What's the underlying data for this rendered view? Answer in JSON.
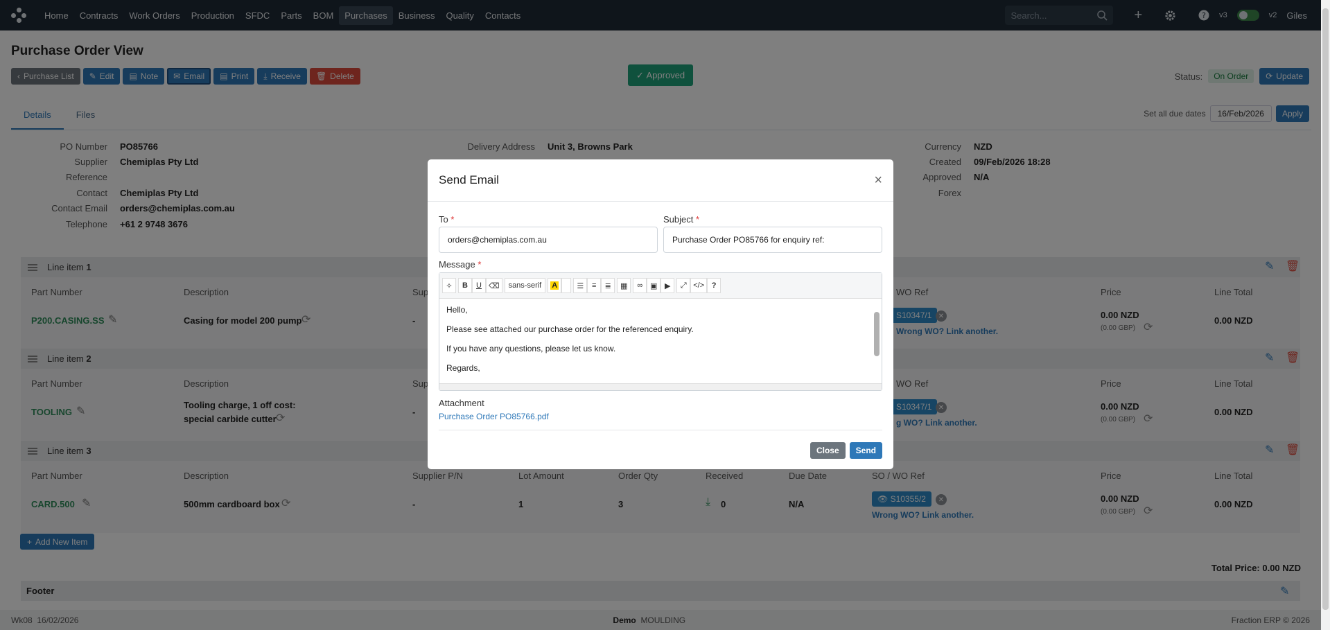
{
  "nav": {
    "items": [
      "Home",
      "Contracts",
      "Work Orders",
      "Production",
      "SFDC",
      "Parts",
      "BOM",
      "Purchases",
      "Business",
      "Quality",
      "Contacts"
    ],
    "active_index": 7,
    "search_placeholder": "Search...",
    "v3": "v3",
    "v2": "v2",
    "user": "Giles"
  },
  "page": {
    "title": "Purchase Order View",
    "toolbar": {
      "purchase_list": "Purchase List",
      "edit": "Edit",
      "note": "Note",
      "email": "Email",
      "print": "Print",
      "receive": "Receive",
      "delete": "Delete"
    },
    "approved": "Approved",
    "status_label": "Status:",
    "status_value": "On Order",
    "update": "Update",
    "tabs": [
      "Details",
      "Files"
    ],
    "due_label": "Set all due dates",
    "due_value": "16/Feb/2026",
    "apply": "Apply"
  },
  "info": {
    "left": [
      {
        "label": "PO Number",
        "value": "PO85766"
      },
      {
        "label": "Supplier",
        "value": "Chemiplas Pty Ltd"
      },
      {
        "label": "Reference",
        "value": ""
      },
      {
        "label": "Contact",
        "value": "Chemiplas Pty Ltd"
      },
      {
        "label": "Contact Email",
        "value": "orders@chemiplas.com.au"
      },
      {
        "label": "Telephone",
        "value": "+61 2 9748 3676"
      }
    ],
    "middle": [
      {
        "label": "Delivery Address",
        "value": "Unit 3, Browns Park"
      }
    ],
    "right": [
      {
        "label": "Currency",
        "value": "NZD"
      },
      {
        "label": "Created",
        "value": "09/Feb/2026 18:28"
      },
      {
        "label": "Approved",
        "value": "N/A"
      },
      {
        "label": "Forex",
        "value": ""
      }
    ]
  },
  "columns": {
    "part": "Part Number",
    "desc": "Description",
    "supp": "Supplier P/N",
    "lot": "Lot Amount",
    "qty": "Order Qty",
    "recv": "Received",
    "due": "Due Date",
    "so": "SO / WO Ref",
    "price": "Price",
    "total": "Line Total",
    "supp_short": "Sup",
    "so_short": "WO Ref"
  },
  "lines": [
    {
      "title": "Line item",
      "num": "1",
      "part": "P200.CASING.SS",
      "desc1": "Casing for model 200 pump",
      "desc2": "",
      "supp": "-",
      "so": "S10347/1",
      "wrong": "Wrong WO? Link another.",
      "price": "0.00 NZD",
      "price_gbp": "(0.00 GBP)",
      "total": "0.00 NZD"
    },
    {
      "title": "Line item",
      "num": "2",
      "part": "TOOLING",
      "desc1": "Tooling charge, 1 off cost:",
      "desc2": "special carbide cutter",
      "supp": "-",
      "so": "S10347/1",
      "wrong": "g WO? Link another.",
      "price": "0.00 NZD",
      "price_gbp": "(0.00 GBP)",
      "total": "0.00 NZD"
    },
    {
      "title": "Line item",
      "num": "3",
      "part": "CARD.500",
      "desc1": "500mm cardboard box",
      "desc2": "",
      "supp": "-",
      "lot": "1",
      "qty": "3",
      "recv": "0",
      "due": "N/A",
      "so": "S10355/2",
      "wrong": "Wrong WO? Link another.",
      "price": "0.00 NZD",
      "price_gbp": "(0.00 GBP)",
      "total": "0.00 NZD"
    }
  ],
  "add_item": "Add New Item",
  "total_price": "Total Price: 0.00 NZD",
  "footer_title": "Footer",
  "statusbar": {
    "week": "Wk08",
    "date": "16/02/2026",
    "demo": "Demo",
    "moulding": "MOULDING",
    "copyright": "Fraction ERP © 2026"
  },
  "modal": {
    "title": "Send Email",
    "to_label": "To",
    "to_value": "orders@chemiplas.com.au",
    "subject_label": "Subject",
    "subject_value": "Purchase Order PO85766 for enquiry ref:",
    "message_label": "Message",
    "font_label": "sans-serif",
    "body": [
      "Hello,",
      "Please see attached our purchase order for the referenced enquiry.",
      "If you have any questions, please let us know.",
      "Regards,"
    ],
    "attachment_label": "Attachment",
    "attachment_file": "Purchase Order PO85766.pdf",
    "close": "Close",
    "send": "Send",
    "required_mark": "*"
  }
}
